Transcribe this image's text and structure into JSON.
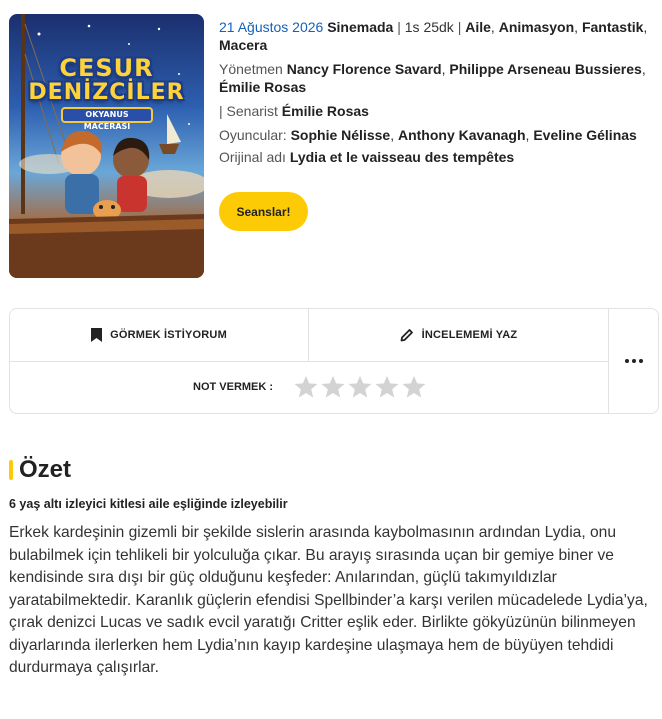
{
  "poster": {
    "title_line1": "CESUR",
    "title_line2": "DENİZCİLER",
    "subtitle": "OKYANUS MACERASI"
  },
  "meta": {
    "date": "21 Ağustos 2026",
    "release": "Sinemada",
    "duration": "1s 25dk",
    "genres": [
      "Aile",
      "Animasyon",
      "Fantastik",
      "Macera"
    ],
    "director_label": "Yönetmen",
    "directors": [
      "Nancy Florence Savard",
      "Philippe Arseneau Bussieres",
      "Émilie Rosas"
    ],
    "writer_label": "Senarist",
    "writers": [
      "Émilie Rosas"
    ],
    "cast_label": "Oyuncular:",
    "cast": [
      "Sophie Nélisse",
      "Anthony Kavanagh",
      "Eveline Gélinas"
    ],
    "original_title_label": "Orijinal adı",
    "original_title": "Lydia et le vaisseau des tempêtes"
  },
  "buttons": {
    "sessions": "Seanslar!",
    "want_to_see": "GÖRMEK İSTİYORUM",
    "write_review": "İNCELEMEMİ YAZ",
    "rate_label": "NOT VERMEK :"
  },
  "rating": {
    "value": 0,
    "max": 5
  },
  "summary": {
    "heading": "Özet",
    "age_note": "6 yaş altı izleyici kitlesi aile eşliğinde izleyebilir",
    "text": "Erkek kardeşinin gizemli bir şekilde sislerin arasında kaybolmasının ardından Lydia, onu bulabilmek için tehlikeli bir yolculuğa çıkar. Bu arayış sırasında uçan bir gemiye biner ve kendisinde sıra dışı bir güç olduğunu keşfeder: Anılarından, güçlü takımyıldızlar yaratabilmektedir. Karanlık güçlerin efendisi Spellbinder’a karşı verilen mücadelede Lydia’ya, çırak denizci Lucas ve sadık evcil yaratığı Critter eşlik eder. Birlikte gökyüzünün bilinmeyen diyarlarında ilerlerken hem Lydia’nın kayıp kardeşine ulaşmaya hem de büyüyen tehdidi durdurmaya çalışırlar."
  },
  "colors": {
    "accent": "#fccb05",
    "link": "#1560bd",
    "star_empty": "#d3d3d3"
  },
  "icons": {
    "want": "bookmark-icon",
    "review": "pencil-icon",
    "more": "more-dots-icon",
    "star": "star-icon"
  }
}
